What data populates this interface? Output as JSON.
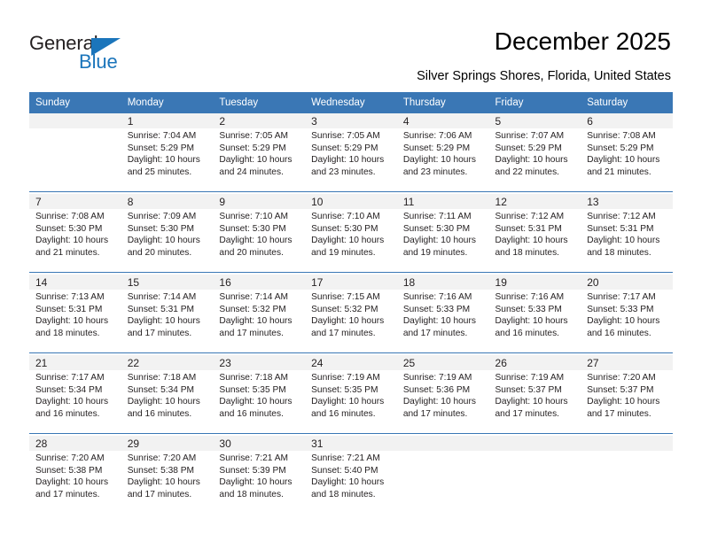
{
  "branding": {
    "name_part1": "General",
    "name_part2": "Blue",
    "accent_color": "#1b75bb"
  },
  "header": {
    "title": "December 2025",
    "subtitle": "Silver Springs Shores, Florida, United States",
    "header_bg": "#3a77b5"
  },
  "labels": {
    "sunrise": "Sunrise:",
    "sunset": "Sunset:",
    "daylight": "Daylight:"
  },
  "weekdays": [
    "Sunday",
    "Monday",
    "Tuesday",
    "Wednesday",
    "Thursday",
    "Friday",
    "Saturday"
  ],
  "weeks": [
    [
      {
        "day": "",
        "sunrise": "",
        "sunset": "",
        "daylight_1": "",
        "daylight_2": ""
      },
      {
        "day": "1",
        "sunrise": "Sunrise: 7:04 AM",
        "sunset": "Sunset: 5:29 PM",
        "daylight_1": "Daylight: 10 hours",
        "daylight_2": "and 25 minutes."
      },
      {
        "day": "2",
        "sunrise": "Sunrise: 7:05 AM",
        "sunset": "Sunset: 5:29 PM",
        "daylight_1": "Daylight: 10 hours",
        "daylight_2": "and 24 minutes."
      },
      {
        "day": "3",
        "sunrise": "Sunrise: 7:05 AM",
        "sunset": "Sunset: 5:29 PM",
        "daylight_1": "Daylight: 10 hours",
        "daylight_2": "and 23 minutes."
      },
      {
        "day": "4",
        "sunrise": "Sunrise: 7:06 AM",
        "sunset": "Sunset: 5:29 PM",
        "daylight_1": "Daylight: 10 hours",
        "daylight_2": "and 23 minutes."
      },
      {
        "day": "5",
        "sunrise": "Sunrise: 7:07 AM",
        "sunset": "Sunset: 5:29 PM",
        "daylight_1": "Daylight: 10 hours",
        "daylight_2": "and 22 minutes."
      },
      {
        "day": "6",
        "sunrise": "Sunrise: 7:08 AM",
        "sunset": "Sunset: 5:29 PM",
        "daylight_1": "Daylight: 10 hours",
        "daylight_2": "and 21 minutes."
      }
    ],
    [
      {
        "day": "7",
        "sunrise": "Sunrise: 7:08 AM",
        "sunset": "Sunset: 5:30 PM",
        "daylight_1": "Daylight: 10 hours",
        "daylight_2": "and 21 minutes."
      },
      {
        "day": "8",
        "sunrise": "Sunrise: 7:09 AM",
        "sunset": "Sunset: 5:30 PM",
        "daylight_1": "Daylight: 10 hours",
        "daylight_2": "and 20 minutes."
      },
      {
        "day": "9",
        "sunrise": "Sunrise: 7:10 AM",
        "sunset": "Sunset: 5:30 PM",
        "daylight_1": "Daylight: 10 hours",
        "daylight_2": "and 20 minutes."
      },
      {
        "day": "10",
        "sunrise": "Sunrise: 7:10 AM",
        "sunset": "Sunset: 5:30 PM",
        "daylight_1": "Daylight: 10 hours",
        "daylight_2": "and 19 minutes."
      },
      {
        "day": "11",
        "sunrise": "Sunrise: 7:11 AM",
        "sunset": "Sunset: 5:30 PM",
        "daylight_1": "Daylight: 10 hours",
        "daylight_2": "and 19 minutes."
      },
      {
        "day": "12",
        "sunrise": "Sunrise: 7:12 AM",
        "sunset": "Sunset: 5:31 PM",
        "daylight_1": "Daylight: 10 hours",
        "daylight_2": "and 18 minutes."
      },
      {
        "day": "13",
        "sunrise": "Sunrise: 7:12 AM",
        "sunset": "Sunset: 5:31 PM",
        "daylight_1": "Daylight: 10 hours",
        "daylight_2": "and 18 minutes."
      }
    ],
    [
      {
        "day": "14",
        "sunrise": "Sunrise: 7:13 AM",
        "sunset": "Sunset: 5:31 PM",
        "daylight_1": "Daylight: 10 hours",
        "daylight_2": "and 18 minutes."
      },
      {
        "day": "15",
        "sunrise": "Sunrise: 7:14 AM",
        "sunset": "Sunset: 5:31 PM",
        "daylight_1": "Daylight: 10 hours",
        "daylight_2": "and 17 minutes."
      },
      {
        "day": "16",
        "sunrise": "Sunrise: 7:14 AM",
        "sunset": "Sunset: 5:32 PM",
        "daylight_1": "Daylight: 10 hours",
        "daylight_2": "and 17 minutes."
      },
      {
        "day": "17",
        "sunrise": "Sunrise: 7:15 AM",
        "sunset": "Sunset: 5:32 PM",
        "daylight_1": "Daylight: 10 hours",
        "daylight_2": "and 17 minutes."
      },
      {
        "day": "18",
        "sunrise": "Sunrise: 7:16 AM",
        "sunset": "Sunset: 5:33 PM",
        "daylight_1": "Daylight: 10 hours",
        "daylight_2": "and 17 minutes."
      },
      {
        "day": "19",
        "sunrise": "Sunrise: 7:16 AM",
        "sunset": "Sunset: 5:33 PM",
        "daylight_1": "Daylight: 10 hours",
        "daylight_2": "and 16 minutes."
      },
      {
        "day": "20",
        "sunrise": "Sunrise: 7:17 AM",
        "sunset": "Sunset: 5:33 PM",
        "daylight_1": "Daylight: 10 hours",
        "daylight_2": "and 16 minutes."
      }
    ],
    [
      {
        "day": "21",
        "sunrise": "Sunrise: 7:17 AM",
        "sunset": "Sunset: 5:34 PM",
        "daylight_1": "Daylight: 10 hours",
        "daylight_2": "and 16 minutes."
      },
      {
        "day": "22",
        "sunrise": "Sunrise: 7:18 AM",
        "sunset": "Sunset: 5:34 PM",
        "daylight_1": "Daylight: 10 hours",
        "daylight_2": "and 16 minutes."
      },
      {
        "day": "23",
        "sunrise": "Sunrise: 7:18 AM",
        "sunset": "Sunset: 5:35 PM",
        "daylight_1": "Daylight: 10 hours",
        "daylight_2": "and 16 minutes."
      },
      {
        "day": "24",
        "sunrise": "Sunrise: 7:19 AM",
        "sunset": "Sunset: 5:35 PM",
        "daylight_1": "Daylight: 10 hours",
        "daylight_2": "and 16 minutes."
      },
      {
        "day": "25",
        "sunrise": "Sunrise: 7:19 AM",
        "sunset": "Sunset: 5:36 PM",
        "daylight_1": "Daylight: 10 hours",
        "daylight_2": "and 17 minutes."
      },
      {
        "day": "26",
        "sunrise": "Sunrise: 7:19 AM",
        "sunset": "Sunset: 5:37 PM",
        "daylight_1": "Daylight: 10 hours",
        "daylight_2": "and 17 minutes."
      },
      {
        "day": "27",
        "sunrise": "Sunrise: 7:20 AM",
        "sunset": "Sunset: 5:37 PM",
        "daylight_1": "Daylight: 10 hours",
        "daylight_2": "and 17 minutes."
      }
    ],
    [
      {
        "day": "28",
        "sunrise": "Sunrise: 7:20 AM",
        "sunset": "Sunset: 5:38 PM",
        "daylight_1": "Daylight: 10 hours",
        "daylight_2": "and 17 minutes."
      },
      {
        "day": "29",
        "sunrise": "Sunrise: 7:20 AM",
        "sunset": "Sunset: 5:38 PM",
        "daylight_1": "Daylight: 10 hours",
        "daylight_2": "and 17 minutes."
      },
      {
        "day": "30",
        "sunrise": "Sunrise: 7:21 AM",
        "sunset": "Sunset: 5:39 PM",
        "daylight_1": "Daylight: 10 hours",
        "daylight_2": "and 18 minutes."
      },
      {
        "day": "31",
        "sunrise": "Sunrise: 7:21 AM",
        "sunset": "Sunset: 5:40 PM",
        "daylight_1": "Daylight: 10 hours",
        "daylight_2": "and 18 minutes."
      },
      {
        "day": "",
        "sunrise": "",
        "sunset": "",
        "daylight_1": "",
        "daylight_2": ""
      },
      {
        "day": "",
        "sunrise": "",
        "sunset": "",
        "daylight_1": "",
        "daylight_2": ""
      },
      {
        "day": "",
        "sunrise": "",
        "sunset": "",
        "daylight_1": "",
        "daylight_2": ""
      }
    ]
  ]
}
